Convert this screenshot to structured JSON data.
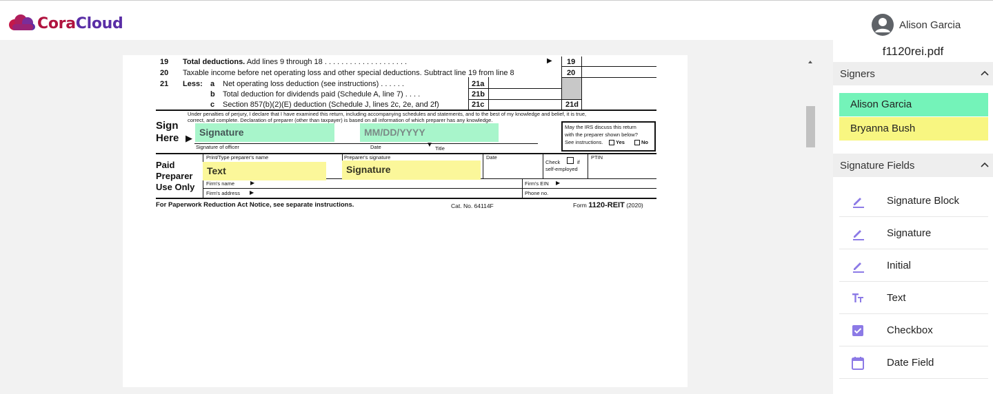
{
  "app": {
    "logo_text_1": "Cora",
    "logo_text_2": "Cloud",
    "user_name": "Alison Garcia"
  },
  "colors": {
    "brand_red": "#b0133f",
    "brand_purple": "#5a2ea6",
    "signer_green": "#74f3b9",
    "signer_yellow": "#f8f681",
    "icon_purple": "#8c7ae6"
  },
  "document": {
    "file_name": "f1120rei.pdf",
    "form": {
      "line19_num": "19",
      "line19_text_bold": "Total deductions.",
      "line19_text": "Add lines 9 through 18 . . . . . . . . . . . . . . . . . . . .",
      "line19_box": "19",
      "line20_num": "20",
      "line20_text": "Taxable income before net operating loss and other special deductions. Subtract line 19 from line 8",
      "line20_box": "20",
      "line21_num": "21",
      "line21_less": "Less:",
      "line21a_letter": "a",
      "line21a_text": "Net operating loss deduction (see instructions) . . . . . .",
      "line21a_box": "21a",
      "line21b_letter": "b",
      "line21b_text": "Total deduction for dividends paid (Schedule A, line 7) . . . .",
      "line21b_box": "21b",
      "line21c_letter": "c",
      "line21c_text": "Section 857(b)(2)(E) deduction (Schedule J, lines 2c, 2e, and 2f)",
      "line21c_box": "21c",
      "line21d_box": "21d",
      "perjury_text": "Under penalties of perjury, I declare that I have examined this return, including accompanying schedules and statements, and to the best of my knowledge and belief, it is true,",
      "perjury_text2": "correct, and complete. Declaration of preparer (other than taxpayer) is based on all information of which preparer has any knowledge.",
      "sign_here_1": "Sign",
      "sign_here_2": "Here",
      "sig_officer_label": "Signature of officer",
      "date_label": "Date",
      "title_label": "Title",
      "irs_discuss_1": "May the IRS discuss this return",
      "irs_discuss_2": "with the preparer shown below?",
      "irs_discuss_3": "See instructions.",
      "yes_label": "Yes",
      "no_label": "No",
      "paid_1": "Paid",
      "paid_2": "Preparer",
      "paid_3": "Use Only",
      "preparer_name_label": "Print/Type preparer's name",
      "preparer_sig_label": "Preparer's signature",
      "preparer_date_label": "Date",
      "check_label": "Check",
      "if_label": "if",
      "self_employed_label": "self-employed",
      "ptin_label": "PTIN",
      "firm_name_label": "Firm's name",
      "firm_ein_label": "Firm's EIN",
      "firm_address_label": "Firm's address",
      "phone_label": "Phone no.",
      "paperwork_text": "For Paperwork Reduction Act Notice, see separate instructions.",
      "cat_no": "Cat. No. 64114F",
      "form_word": "Form",
      "form_name": "1120-REIT",
      "form_year": "(2020)"
    },
    "placed_fields": {
      "signature_1": "Signature",
      "date_1": "MM/DD/YYYY",
      "text_1": "Text",
      "signature_2": "Signature"
    }
  },
  "sidebar": {
    "signers_title": "Signers",
    "signers": [
      {
        "name": "Alison Garcia",
        "color": "#74f3b9"
      },
      {
        "name": "Bryanna Bush",
        "color": "#f8f681"
      }
    ],
    "fields_title": "Signature Fields",
    "fields": [
      {
        "label": "Signature Block",
        "icon": "pencil-icon"
      },
      {
        "label": "Signature",
        "icon": "pencil-icon"
      },
      {
        "label": "Initial",
        "icon": "pencil-icon"
      },
      {
        "label": "Text",
        "icon": "text-format-icon"
      },
      {
        "label": "Checkbox",
        "icon": "checkbox-icon"
      },
      {
        "label": "Date Field",
        "icon": "calendar-icon"
      }
    ]
  }
}
